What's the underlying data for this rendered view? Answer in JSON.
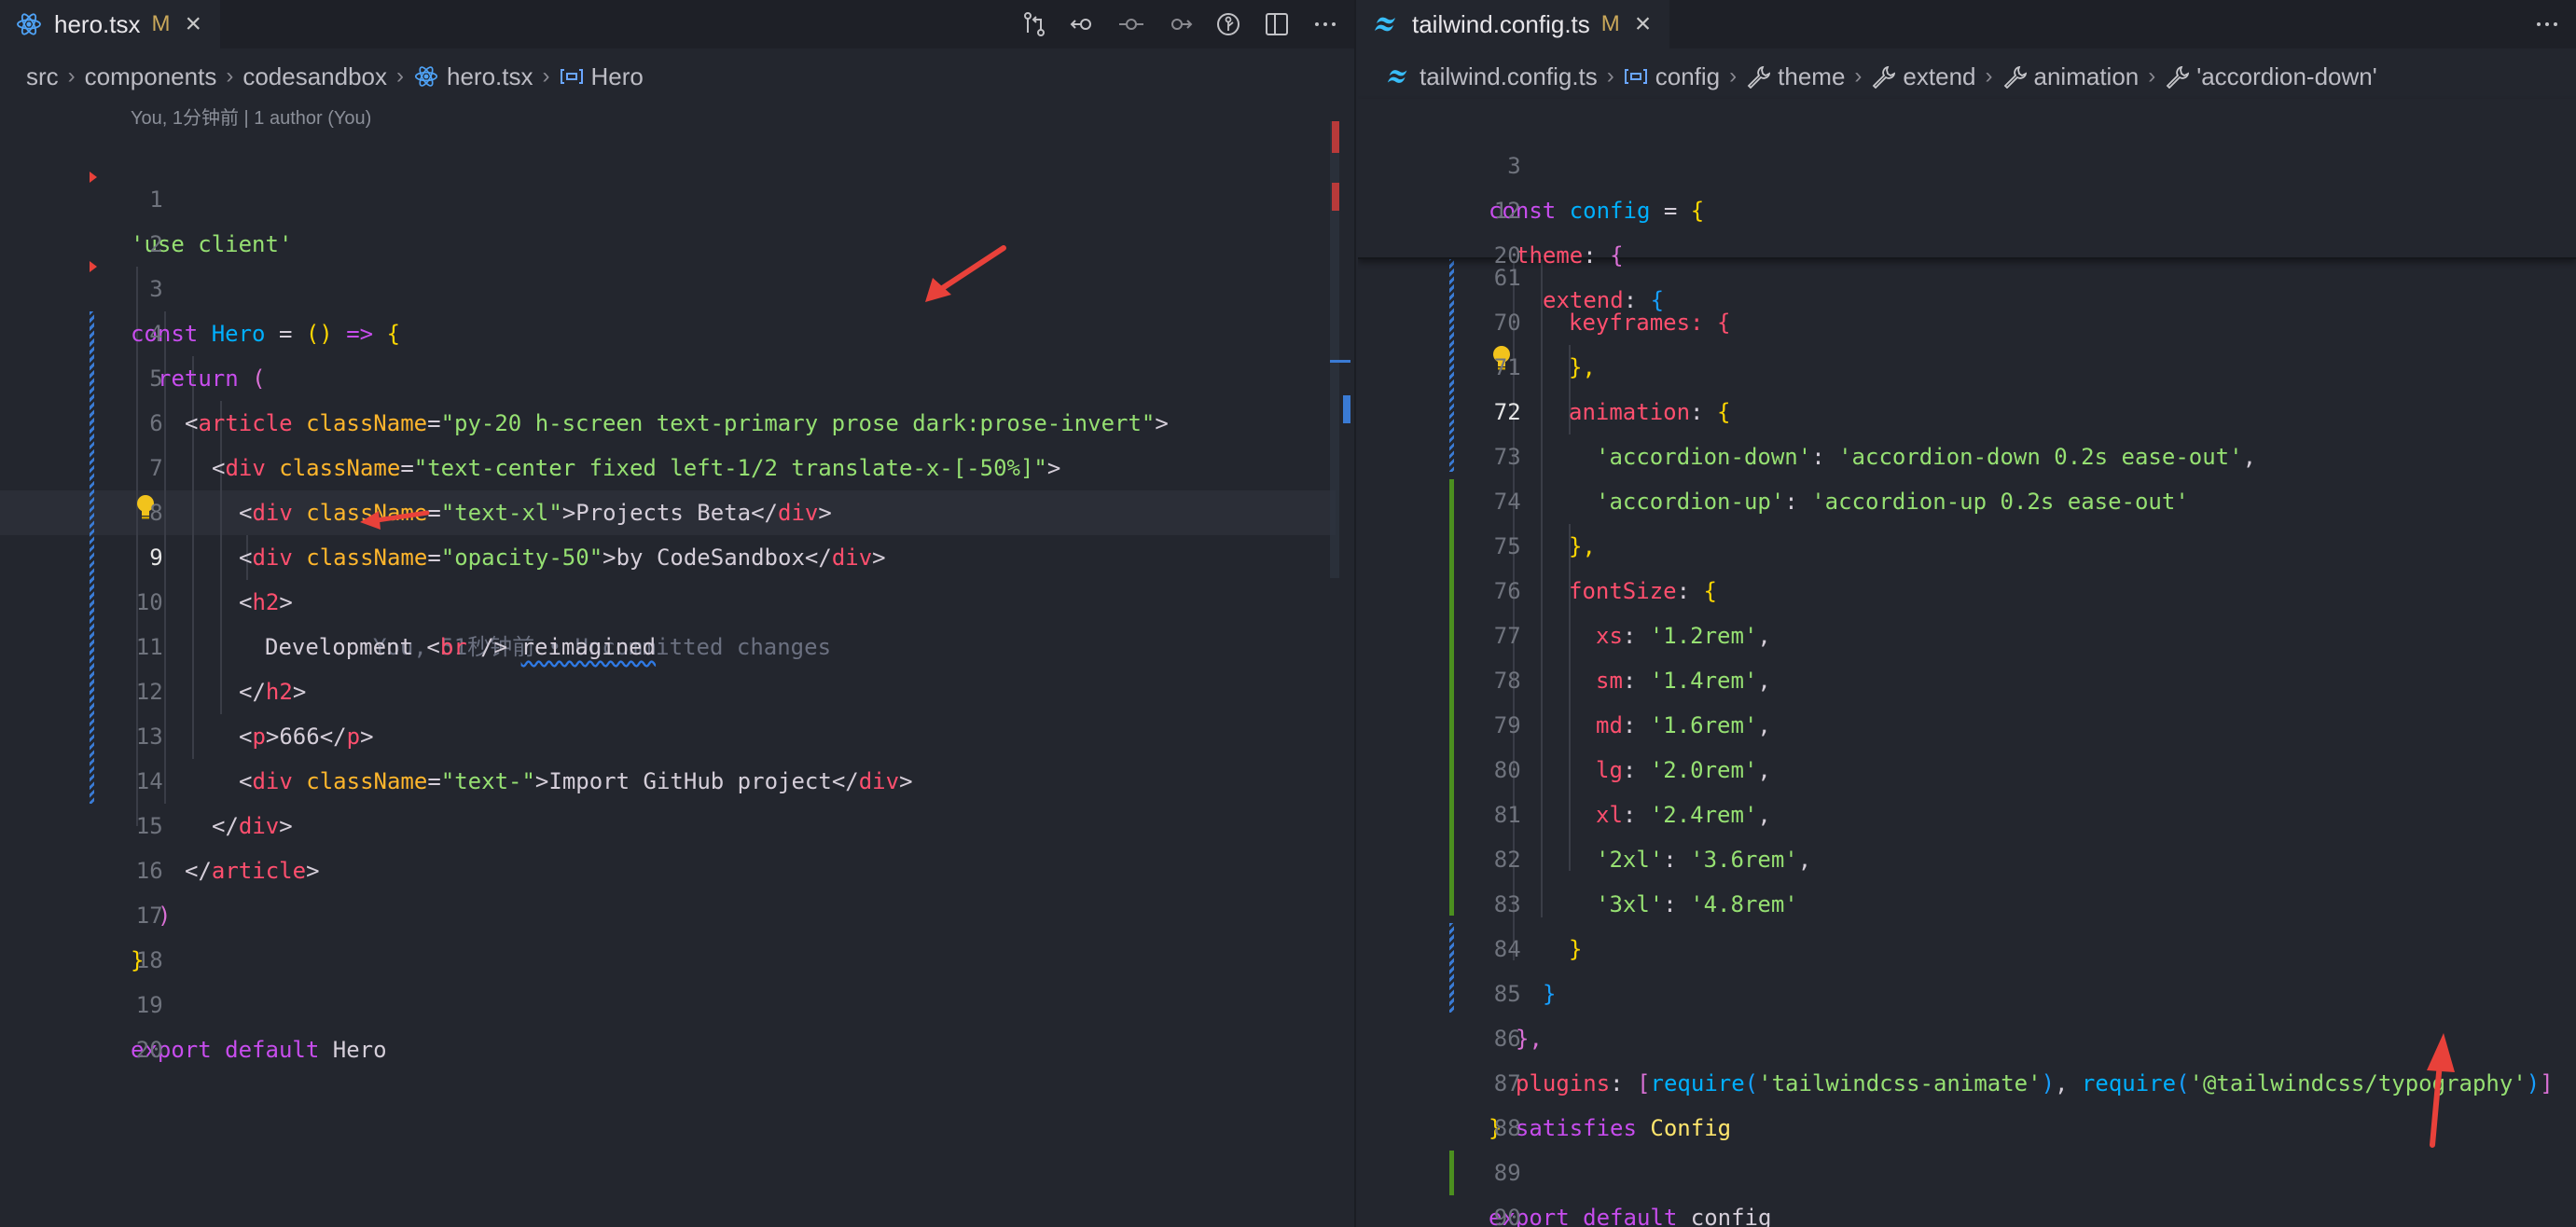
{
  "left": {
    "tab": {
      "label": "hero.tsx",
      "modified": "M"
    },
    "actions": [
      "open-changes-icon",
      "go-back-icon",
      "commit-icon",
      "go-forward-icon",
      "timeline-icon",
      "split-editor-icon",
      "more-actions-icon"
    ],
    "breadcrumb": [
      "src",
      "components",
      "codesandbox",
      "hero.tsx",
      "Hero"
    ],
    "blame_header": "You, 1分钟前 | 1 author (You)",
    "inline_blame": "You, 51秒钟前 • Uncommitted changes",
    "line_numbers": [
      "1",
      "2",
      "3",
      "4",
      "5",
      "6",
      "7",
      "8",
      "9",
      "10",
      "11",
      "12",
      "13",
      "14",
      "15",
      "16",
      "17",
      "18",
      "19",
      "20"
    ],
    "code": {
      "l1": "'use client'",
      "l3_kw": "const",
      "l3_name": "Hero",
      "l3_op": " = ",
      "l3_paren": "()",
      "l3_arrow": " => ",
      "l3_brace": "{",
      "l4_kw": "return",
      "l4_paren": "(",
      "l5_attr": "className",
      "l5_val": "\"py-20 h-screen text-primary prose dark:prose-invert\"",
      "l6_attr": "className",
      "l6_val": "\"text-center fixed left-1/2 translate-x-[-50%]\"",
      "l7_attr": "className",
      "l7_val": "\"text-xl\"",
      "l7_text": "Projects Beta",
      "l8_attr": "className",
      "l8_val": "\"opacity-50\"",
      "l8_text": "by CodeSandbox",
      "l10_text": "Development ",
      "l10_br": "br",
      "l10_end": " />",
      "l10_word": "reimagined",
      "l12_text": "666",
      "l13_attr": "className",
      "l13_val": "\"text-\"",
      "l13_text": "Import GitHub project",
      "l16_paren": ")",
      "l17_brace": "}",
      "l19_kw": "export default",
      "l19_name": "Hero",
      "t_article": "article",
      "t_div": "div",
      "t_h2": "h2",
      "t_p": "p"
    }
  },
  "right": {
    "tab": {
      "label": "tailwind.config.ts",
      "modified": "M"
    },
    "actions": [
      "more-actions-icon"
    ],
    "breadcrumb": [
      "tailwind.config.ts",
      "config",
      "theme",
      "extend",
      "animation",
      "'accordion-down'"
    ],
    "sticky": {
      "ln3": "3",
      "ln12": "12",
      "ln20": "20",
      "l3_kw": "const",
      "l3_name": "config",
      "l3_eq": " = ",
      "l3_brace": "{",
      "l12_key": "theme",
      "l12_brace": "{",
      "l20_key": "extend",
      "l20_brace": "{"
    },
    "line_numbers": [
      "61",
      "70",
      "71",
      "72",
      "73",
      "74",
      "75",
      "76",
      "77",
      "78",
      "79",
      "80",
      "81",
      "82",
      "83",
      "84",
      "85",
      "86",
      "87",
      "88",
      "89",
      "90"
    ],
    "code": {
      "l61": "keyframes: {",
      "l70": "},",
      "l71_key": "animation",
      "l71_brace": "{",
      "l72_k": "'accordion-down'",
      "l72_v": "'accordion-down 0.2s ease-out'",
      "l73_k": "'accordion-up'",
      "l73_v": "'accordion-up 0.2s ease-out'",
      "l74": "},",
      "l75_key": "fontSize",
      "l75_brace": "{",
      "l76_k": "xs",
      "l76_v": "'1.2rem'",
      "l77_k": "sm",
      "l77_v": "'1.4rem'",
      "l78_k": "md",
      "l78_v": "'1.6rem'",
      "l79_k": "lg",
      "l79_v": "'2.0rem'",
      "l80_k": "xl",
      "l80_v": "'2.4rem'",
      "l81_k": "'2xl'",
      "l81_v": "'3.6rem'",
      "l82_k": "'3xl'",
      "l82_v": "'4.8rem'",
      "l83": "}",
      "l84": "}",
      "l85": "},",
      "l86_key": "plugins",
      "l86_req": "require",
      "l86_a": "'tailwindcss-animate'",
      "l86_b": "'@tailwindcss/typography'",
      "l87_brace": "}",
      "l87_kw": "satisfies",
      "l87_type": "Config",
      "l89_kw": "export default",
      "l89_name": "config"
    }
  },
  "colors": {
    "background": "#23262e",
    "tabbar": "#1e2027",
    "string": "#96e072",
    "keyword": "#c74ded",
    "tag": "#ff4f6e",
    "attribute": "#ffb62c",
    "function": "#00b0ff",
    "annotation_arrow": "#e8413a"
  }
}
